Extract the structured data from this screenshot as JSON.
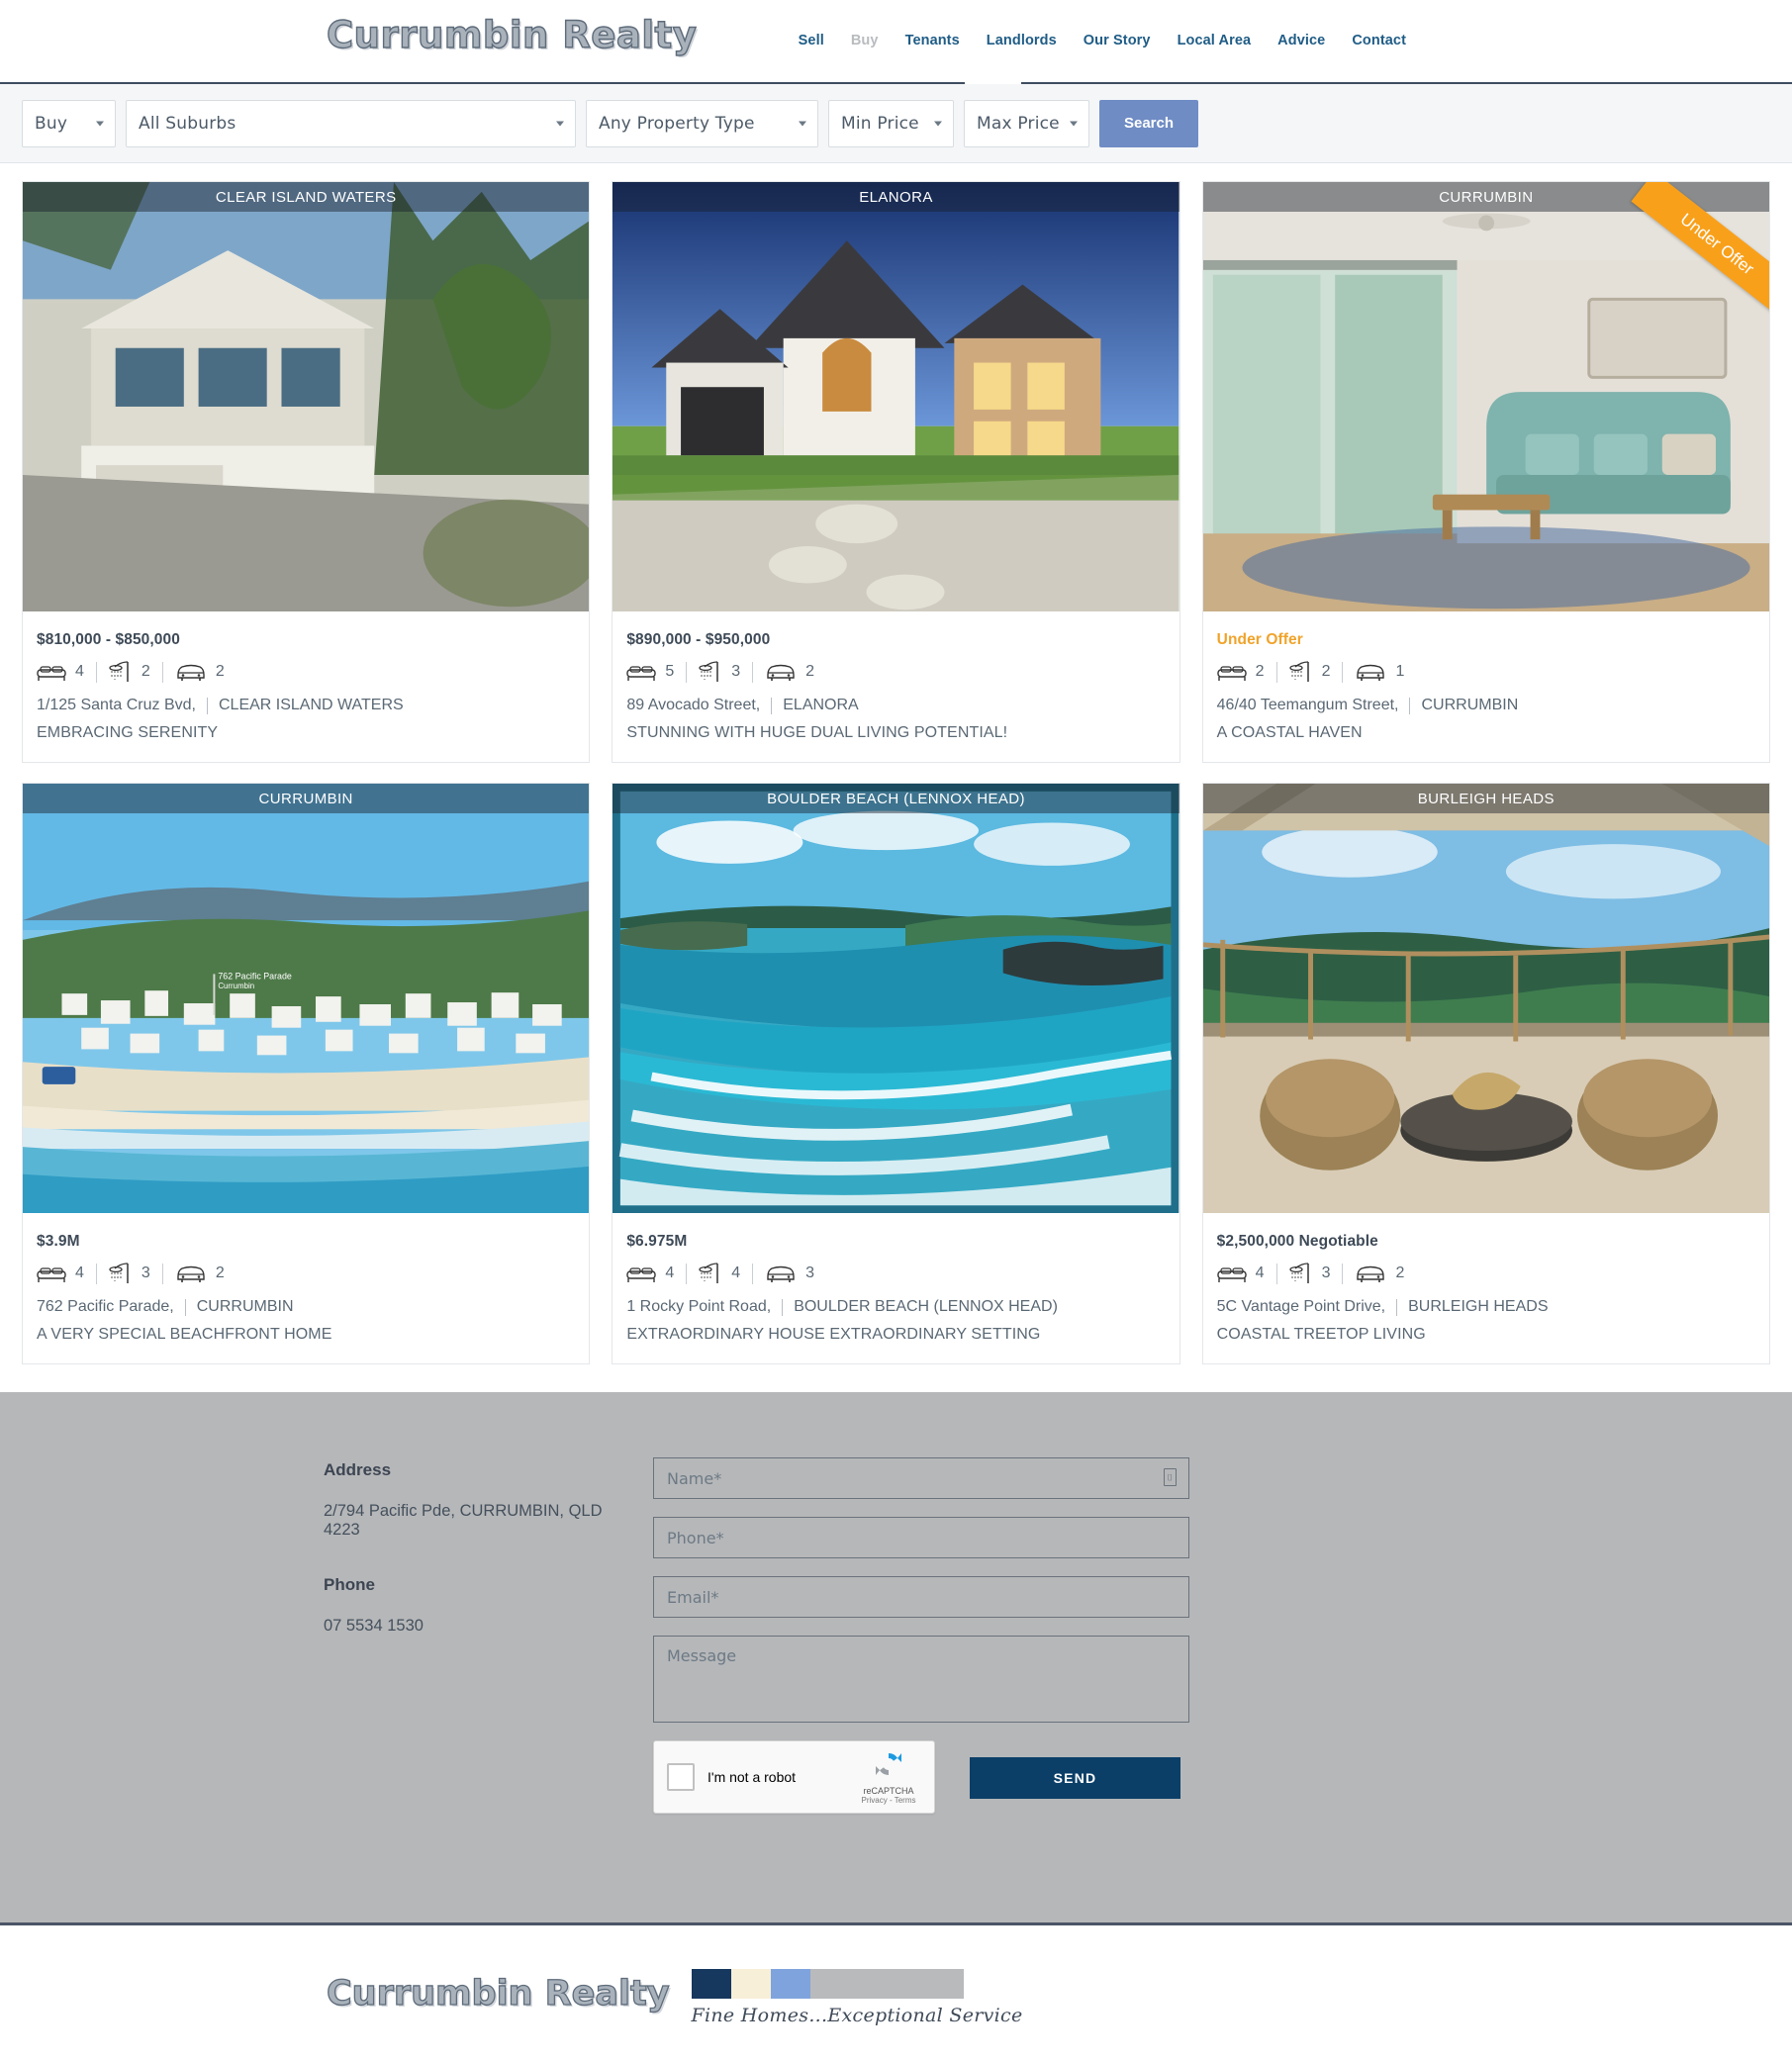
{
  "header": {
    "logo": "Currumbin Realty",
    "nav": [
      {
        "label": "Sell",
        "active": false
      },
      {
        "label": "Buy",
        "active": true
      },
      {
        "label": "Tenants",
        "active": false
      },
      {
        "label": "Landlords",
        "active": false
      },
      {
        "label": "Our Story",
        "active": false
      },
      {
        "label": "Local Area",
        "active": false
      },
      {
        "label": "Advice",
        "active": false
      },
      {
        "label": "Contact",
        "active": false
      }
    ]
  },
  "search": {
    "mode": "Buy",
    "suburb": "All Suburbs",
    "property_type": "Any Property Type",
    "min_price": "Min Price",
    "max_price": "Max Price",
    "button": "Search"
  },
  "listings": [
    {
      "suburb_bar": "CLEAR ISLAND WATERS",
      "price": "$810,000 - $850,000",
      "under_offer": false,
      "beds": "4",
      "baths": "2",
      "cars": "2",
      "street": "1/125 Santa Cruz Bvd,",
      "suburb": "CLEAR ISLAND WATERS",
      "tagline": "EMBRACING SERENITY"
    },
    {
      "suburb_bar": "ELANORA",
      "price": "$890,000 - $950,000",
      "under_offer": false,
      "beds": "5",
      "baths": "3",
      "cars": "2",
      "street": "89 Avocado Street,",
      "suburb": "ELANORA",
      "tagline": "STUNNING WITH HUGE DUAL LIVING POTENTIAL!"
    },
    {
      "suburb_bar": "CURRUMBIN",
      "price": "Under Offer",
      "under_offer": true,
      "ribbon": "Under Offer",
      "beds": "2",
      "baths": "2",
      "cars": "1",
      "street": "46/40 Teemangum Street,",
      "suburb": "CURRUMBIN",
      "tagline": "A COASTAL HAVEN"
    },
    {
      "suburb_bar": "CURRUMBIN",
      "price": "$3.9M",
      "under_offer": false,
      "beds": "4",
      "baths": "3",
      "cars": "2",
      "street": "762 Pacific Parade,",
      "suburb": "CURRUMBIN",
      "tagline": "A VERY SPECIAL BEACHFRONT HOME"
    },
    {
      "suburb_bar": "BOULDER BEACH (LENNOX HEAD)",
      "price": "$6.975M",
      "under_offer": false,
      "beds": "4",
      "baths": "4",
      "cars": "3",
      "street": "1 Rocky Point Road,",
      "suburb": "BOULDER BEACH (LENNOX HEAD)",
      "tagline": "EXTRAORDINARY HOUSE EXTRAORDINARY SETTING"
    },
    {
      "suburb_bar": "BURLEIGH HEADS",
      "price": "$2,500,000 Negotiable",
      "under_offer": false,
      "beds": "4",
      "baths": "3",
      "cars": "2",
      "street": "5C Vantage Point Drive,",
      "suburb": "BURLEIGH HEADS",
      "tagline": "COASTAL TREETOP LIVING"
    }
  ],
  "footer": {
    "address_head": "Address",
    "address_text": "2/794 Pacific Pde, CURRUMBIN, QLD 4223",
    "phone_head": "Phone",
    "phone_text": "07 5534 1530",
    "form": {
      "name_placeholder": "Name*",
      "phone_placeholder": "Phone*",
      "email_placeholder": "Email*",
      "message_placeholder": "Message",
      "send_label": "SEND"
    },
    "captcha": {
      "label": "I'm not a robot",
      "brand": "reCAPTCHA",
      "terms": "Privacy - Terms"
    }
  },
  "bottom": {
    "logo": "Currumbin Realty",
    "slogan": "Fine Homes...Exceptional Service",
    "swatches": [
      "#16375e",
      "#f7efd8",
      "#7fa4dd",
      "#b9babc"
    ]
  },
  "colors": {
    "nav_link": "#1f5c86",
    "nav_active": "#b9bcbf",
    "search_btn": "#6f8cc4",
    "offer_orange": "#f0a32a",
    "send_blue": "#0b3f68",
    "footer_bg": "#b6b7b9"
  }
}
